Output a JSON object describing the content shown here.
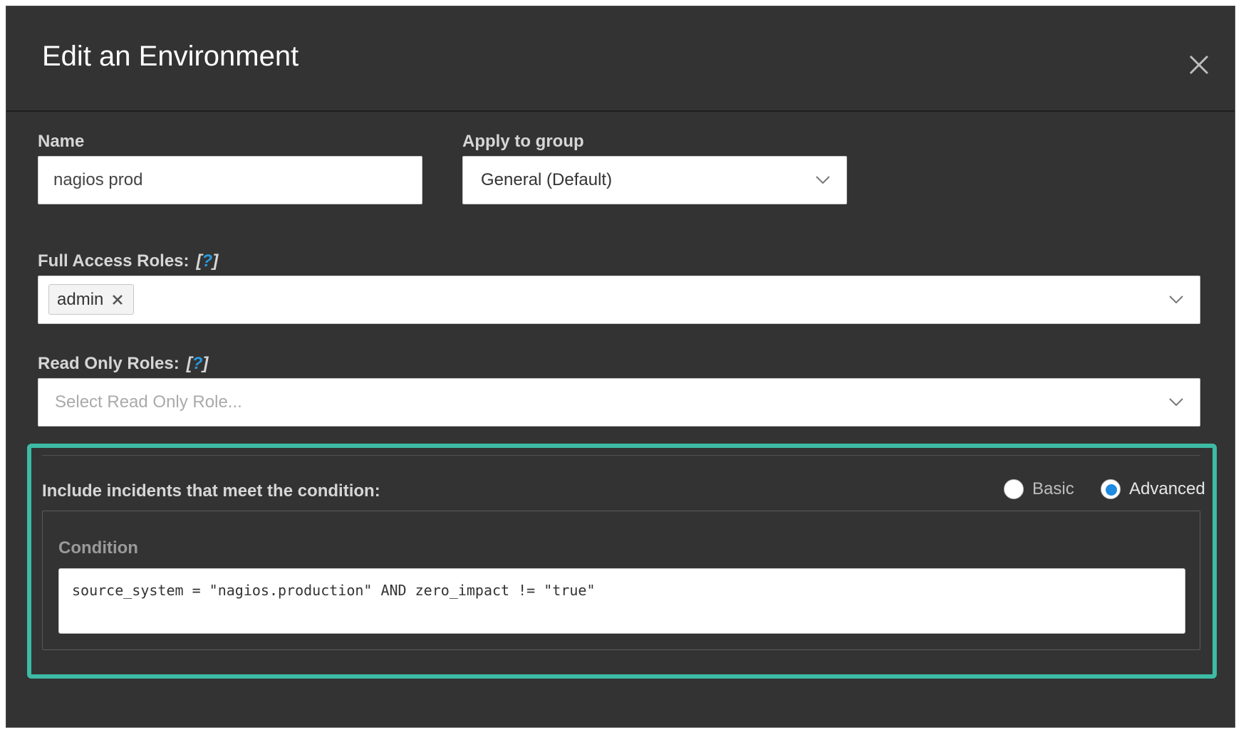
{
  "modal": {
    "title": "Edit an Environment",
    "close_icon": "close-icon"
  },
  "name_field": {
    "label": "Name",
    "value": "nagios prod"
  },
  "group_field": {
    "label": "Apply to group",
    "selected": "General (Default)",
    "icon": "chevron-down-icon"
  },
  "full_access_roles": {
    "label": "Full Access Roles:",
    "help_open": "[",
    "help_q": "?",
    "help_close": "]",
    "tags": [
      {
        "label": "admin",
        "remove_icon": "remove-tag-icon"
      }
    ],
    "icon": "chevron-down-icon"
  },
  "read_only_roles": {
    "label": "Read Only Roles:",
    "help_open": "[",
    "help_q": "?",
    "help_close": "]",
    "placeholder": "Select Read Only Role...",
    "icon": "chevron-down-icon"
  },
  "incident_condition": {
    "label": "Include incidents that meet the condition:",
    "modes": [
      {
        "label": "Basic",
        "checked": false
      },
      {
        "label": "Advanced",
        "checked": true
      }
    ],
    "condition_label": "Condition",
    "condition_value": "source_system = \"nagios.production\" AND zero_impact != \"true\""
  },
  "colors": {
    "modal_bg": "#333333",
    "highlight": "#3dbba4",
    "help_accent": "#2a9be0",
    "radio_selected": "#1e8be0"
  }
}
